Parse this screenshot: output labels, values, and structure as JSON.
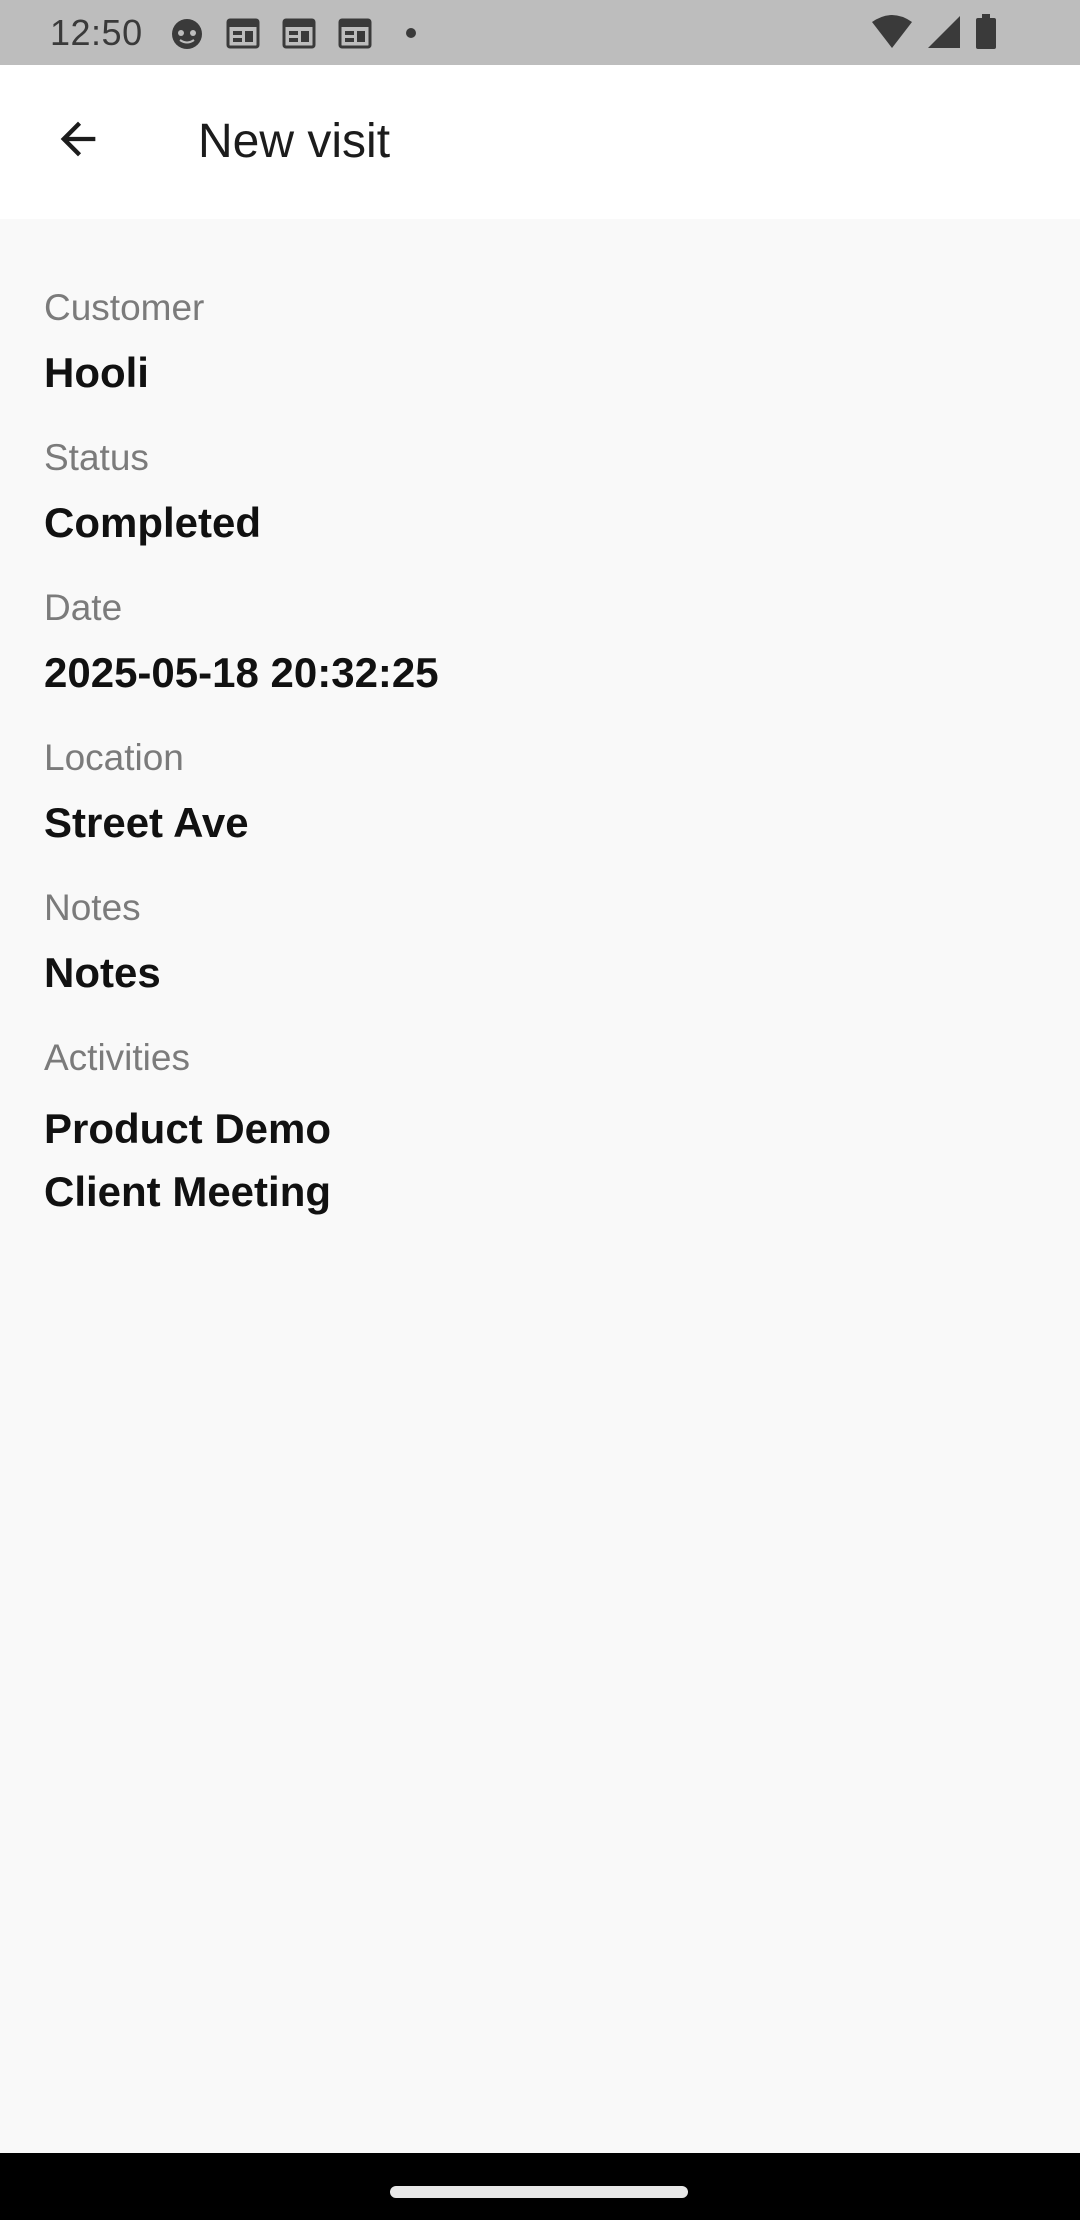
{
  "status_bar": {
    "time": "12:50",
    "left_icons": [
      "cat-face-icon",
      "calendar-icon",
      "calendar-icon",
      "calendar-icon",
      "dot-icon"
    ],
    "right_icons": [
      "wifi-icon",
      "signal-icon",
      "battery-icon"
    ]
  },
  "app_bar": {
    "back_icon": "arrow-back-icon",
    "title": "New visit"
  },
  "fields": {
    "customer": {
      "label": "Customer",
      "value": "Hooli"
    },
    "status": {
      "label": "Status",
      "value": "Completed"
    },
    "date": {
      "label": "Date",
      "value": "2025-05-18 20:32:25"
    },
    "location": {
      "label": "Location",
      "value": "Street Ave"
    },
    "notes": {
      "label": "Notes",
      "value": "Notes"
    },
    "activities": {
      "label": "Activities",
      "items": [
        "Product Demo",
        "Client Meeting"
      ]
    }
  },
  "colors": {
    "status_bar_bg": "#bdbdbd",
    "app_bar_bg": "#ffffff",
    "content_bg": "#f9f9f9",
    "label_text": "#7b7b7b",
    "value_text": "#111111",
    "nav_bar_bg": "#000000"
  }
}
